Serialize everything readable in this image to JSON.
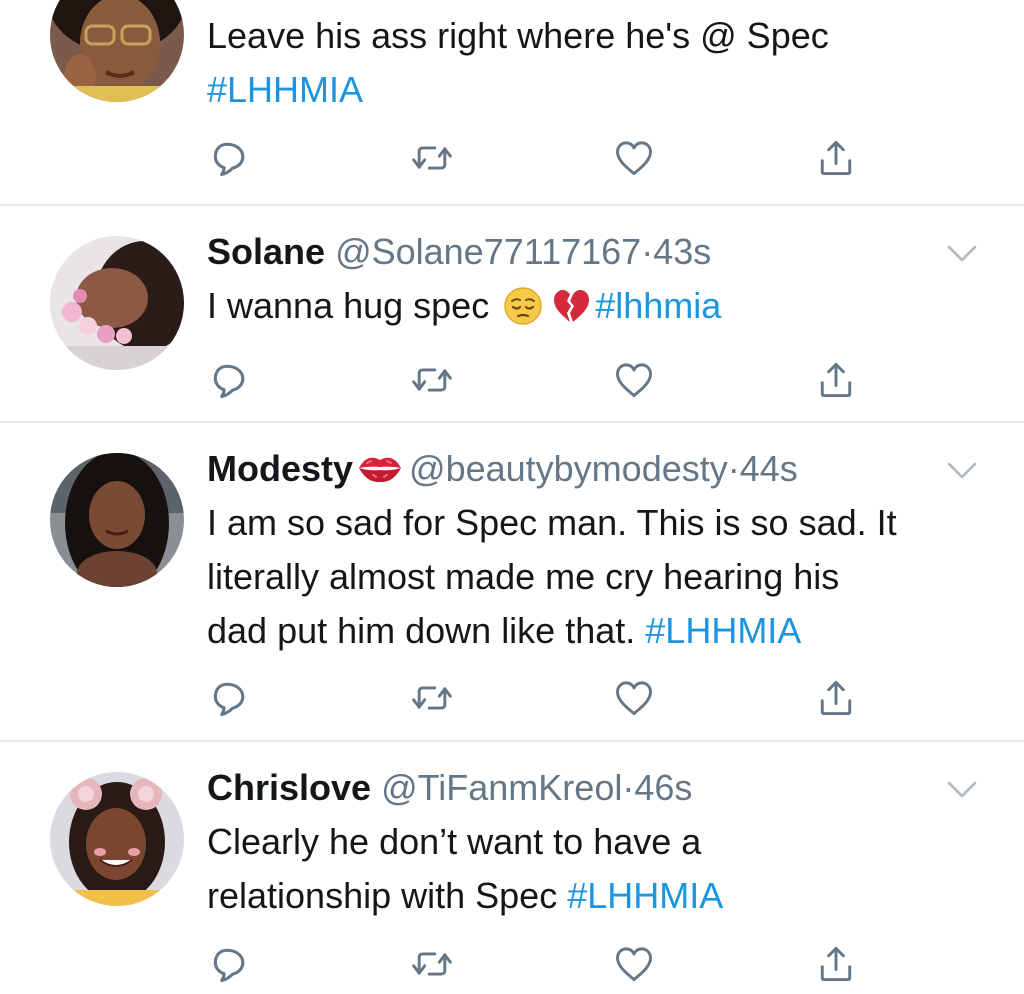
{
  "tweets": [
    {
      "name": "",
      "handle": "",
      "time": "",
      "text_plain": "Leave his ass right where he's @ Spec",
      "hashtag": "#LHHMIA",
      "avatar": "woman-with-glasses"
    },
    {
      "name": "Solane",
      "handle": "@Solane77117167",
      "dot": "·",
      "time": "43s",
      "text_plain": "I wanna hug spec",
      "emoji_1": "pensive-face",
      "emoji_2": "broken-heart",
      "hashtag": "#lhhmia",
      "avatar": "woman-flower-crown"
    },
    {
      "name": "Modesty",
      "name_emoji": "kiss-mark",
      "handle": "@beautybymodesty",
      "dot": "·",
      "time": "44s",
      "text_line1": "I am so sad for Spec man. This is so sad. It",
      "text_line2": "literally almost made me cry hearing his",
      "text_line3": "dad put him down like that.",
      "hashtag": "#LHHMIA",
      "avatar": "woman-long-hair"
    },
    {
      "name": "Chrislove",
      "handle": "@TiFanmKreol",
      "dot": "·",
      "time": "46s",
      "text_line1": "Clearly he don’t want to have a",
      "text_line2": "relationship with Spec",
      "hashtag": "#LHHMIA",
      "avatar": "woman-bear-ears-filter"
    }
  ],
  "icons": {
    "reply": "reply-icon",
    "retweet": "retweet-icon",
    "like": "like-icon",
    "share": "share-icon",
    "menu": "chevron-down-icon"
  },
  "colors": {
    "hashtag": "#1b95e0",
    "secondary_text": "#657786",
    "icon": "#657786",
    "divider": "#e6ecf0"
  }
}
